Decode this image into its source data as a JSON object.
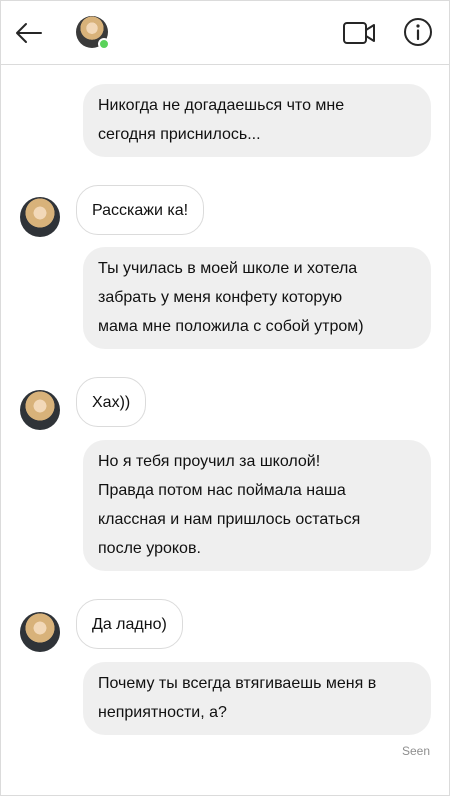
{
  "header": {
    "back_icon": "arrow-left-icon",
    "video_icon": "video-camera-icon",
    "info_icon": "info-icon"
  },
  "messages": [
    {
      "from": "me",
      "text": "Никогда не догадаешься что мне\nсегодня приснилось..."
    },
    {
      "from": "them",
      "text": "Расскажи ка!"
    },
    {
      "from": "me",
      "text": "Ты училась в моей школе и хотела\nзабрать у меня конфету которую\nмама мне положила с собой утром)"
    },
    {
      "from": "them",
      "text": "Хах))"
    },
    {
      "from": "me",
      "text": "Но я тебя проучил за школой!\nПравда потом нас поймала наша\nклассная и нам пришлось остаться\nпосле уроков."
    },
    {
      "from": "them",
      "text": "Да ладно)"
    },
    {
      "from": "me",
      "text": "Почему ты всегда втягиваешь меня в\nнеприятности, а?"
    }
  ],
  "status": {
    "seen_label": "Seen"
  },
  "colors": {
    "online": "#5ad25a",
    "bubble_out": "#efefef",
    "border": "#dbdbdb"
  }
}
